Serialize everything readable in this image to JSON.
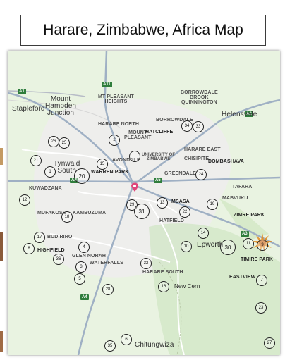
{
  "title": "Harare, Zimbabwe, Africa Map",
  "colors": {
    "land": "#e9f3e1",
    "urban": "#eeeeec",
    "park": "#cfe6c3",
    "road": "#ffffff",
    "major_road": "#9fb0c4",
    "marker_border": "#222222",
    "pin": "#e0457b",
    "burst": "#e08a1e"
  },
  "places": {
    "stapleford": "Stapleford",
    "mount_hampden_junction": "Mount\nHampden\nJunction",
    "mt_pleasant_heights": "MT PLEASANT\nHEIGHTS",
    "borrowdale_brook_quinnington": "BORROWDALE\nBROOK\nQUINNINGTON",
    "helensvale": "Helensvale",
    "borrowdale": "BORROWDALE",
    "harare_north": "HARARE NORTH",
    "mount_pleasant": "MOUNT\nPLEASANT",
    "hatcliffe": "HATCLIFFE",
    "university": "UNIVERSITY OF\nZIMBABWE",
    "harare_east": "HARARE EAST",
    "chisipite": "CHISIPITE",
    "dombashava": "DOMBASHAVA",
    "tynwald_south": "Tynwald\nSouth",
    "warren_park": "WARREN PARK",
    "avondale": "AVONDALE",
    "greendale": "GREENDALE",
    "tafara": "TAFARA",
    "kuwadzana": "KUWADZANA",
    "mabvuku": "MABVUKU",
    "zimre_park": "ZIMRE PARK",
    "mufakose": "MUFAKOSE",
    "kambuzuma": "KAMBUZUMA",
    "msasa": "MSASA",
    "hatfield": "HATFIELD",
    "budiriro": "BUDIRIRO",
    "highfield": "HIGHFIELD",
    "glen_norah": "GLEN NORAH",
    "epworth": "Epworth",
    "timire_park": "TIMIRE PARK",
    "waterfalls": "WATERFALLS",
    "harare_south": "HARARE SOUTH",
    "eastview": "EASTVIEW",
    "new_cern": "New Cern",
    "chitungwiza": "Chitungwiza"
  },
  "roads": {
    "a1": "A1",
    "a11": "A11",
    "a2_west": "A2",
    "a2_east": "A2",
    "a5": "A5",
    "a3": "A3",
    "a4": "A4"
  },
  "markers": [
    "1",
    "2",
    "3",
    "4",
    "5",
    "6",
    "7",
    "8",
    "9",
    "10",
    "11",
    "12",
    "13",
    "14",
    "15",
    "16",
    "17",
    "18",
    "19",
    "20",
    "21",
    "22",
    "23",
    "24",
    "25",
    "26",
    "27",
    "28",
    "29",
    "30",
    "31",
    "32",
    "33",
    "34",
    "35",
    "36"
  ],
  "pin_icon": "location-pin-icon",
  "burst_icon": "starburst-icon"
}
